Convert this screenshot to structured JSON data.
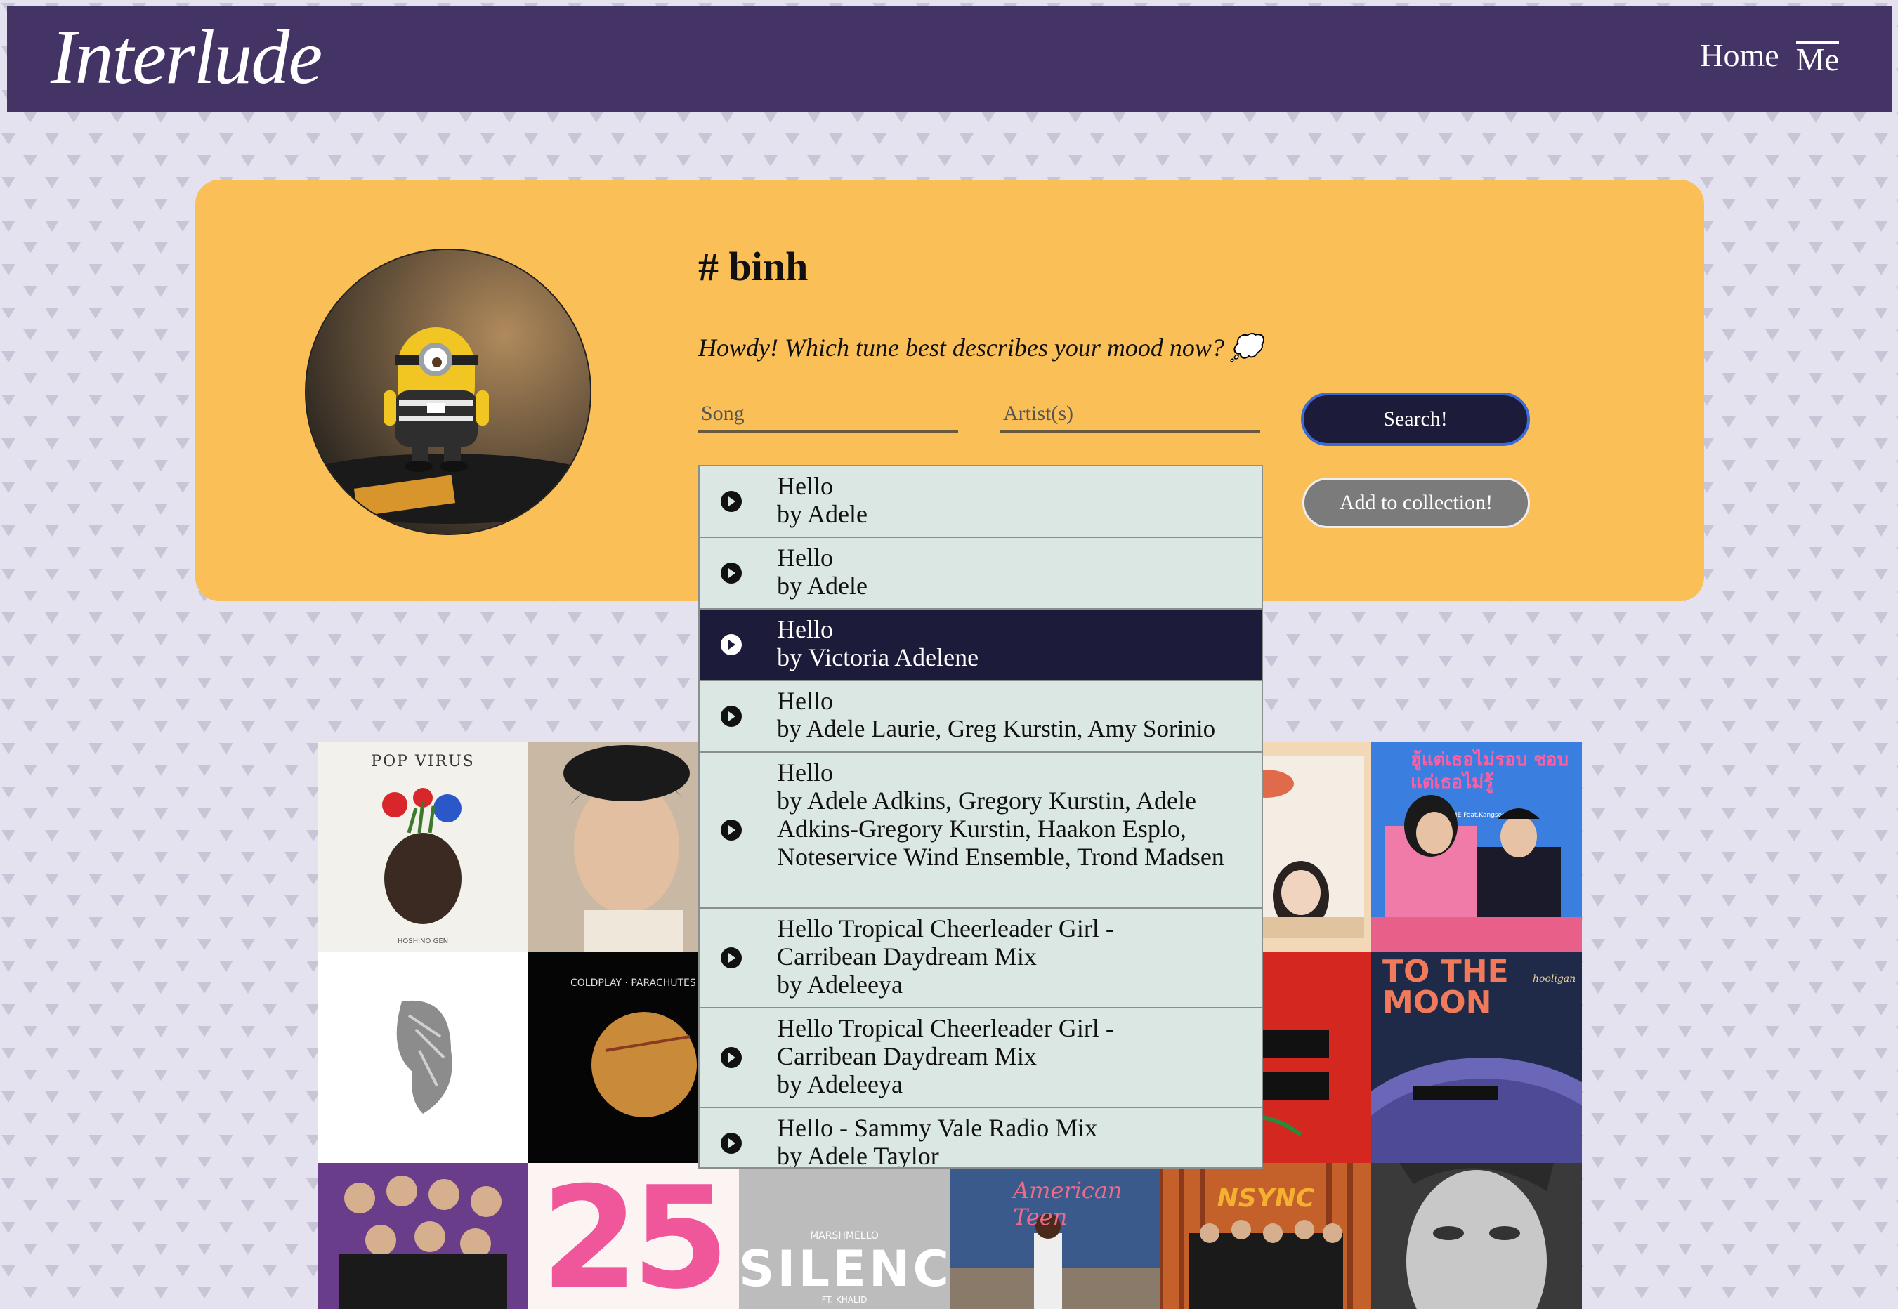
{
  "brand": "Interlude",
  "nav": {
    "home": "Home",
    "me": "Me"
  },
  "profile": {
    "username": "# binh",
    "prompt": "Howdy! Which tune best describes your mood now? 💭",
    "song_placeholder": "Song",
    "artist_placeholder": "Artist(s)",
    "search_label": "Search!",
    "add_label": "Add to collection!"
  },
  "results": [
    {
      "title": "Hello",
      "artist": "by Adele",
      "selected": false
    },
    {
      "title": "Hello",
      "artist": "by Adele",
      "selected": false
    },
    {
      "title": "Hello",
      "artist": "by Victoria Adelene",
      "selected": true
    },
    {
      "title": "Hello",
      "artist": "by Adele Laurie, Greg Kurstin, Amy Sorinio",
      "selected": false
    },
    {
      "title": "Hello",
      "artist": "by Adele Adkins, Gregory Kurstin, Adele Adkins-Gregory Kurstin, Haakon Esplo, Noteservice Wind Ensemble, Trond Madsen",
      "selected": false
    },
    {
      "title": "Hello Tropical Cheerleader Girl - Carribean Daydream Mix",
      "artist": "by Adeleeya",
      "selected": false
    },
    {
      "title": "Hello Tropical Cheerleader Girl - Carribean Daydream Mix",
      "artist": "by Adeleeya",
      "selected": false
    },
    {
      "title": "Hello - Sammy Vale Radio Mix",
      "artist": "by Adele Taylor",
      "selected": false
    }
  ],
  "albums": {
    "pop_virus": "POP VIRUS",
    "pop_virus_artist": "HOSHINO GEN",
    "parachutes": "COLDPLAY · PARACHUTES",
    "thai_1": "ฮู้แต่เธอไม่รอบ ชอบแต่เธอไม่รู้",
    "thai_1_sub": "WONDERFRAME Feat.Kangsomks",
    "to_the_moon": "TO THE MOON",
    "to_the_moon_sig": "hooligan",
    "silence_top": "MARSHMELLO",
    "silence": "SILENCE",
    "silence_sub": "FT. KHALID",
    "american_teen": "American Teen",
    "nsync": "NSYNC",
    "number_25": "25"
  }
}
